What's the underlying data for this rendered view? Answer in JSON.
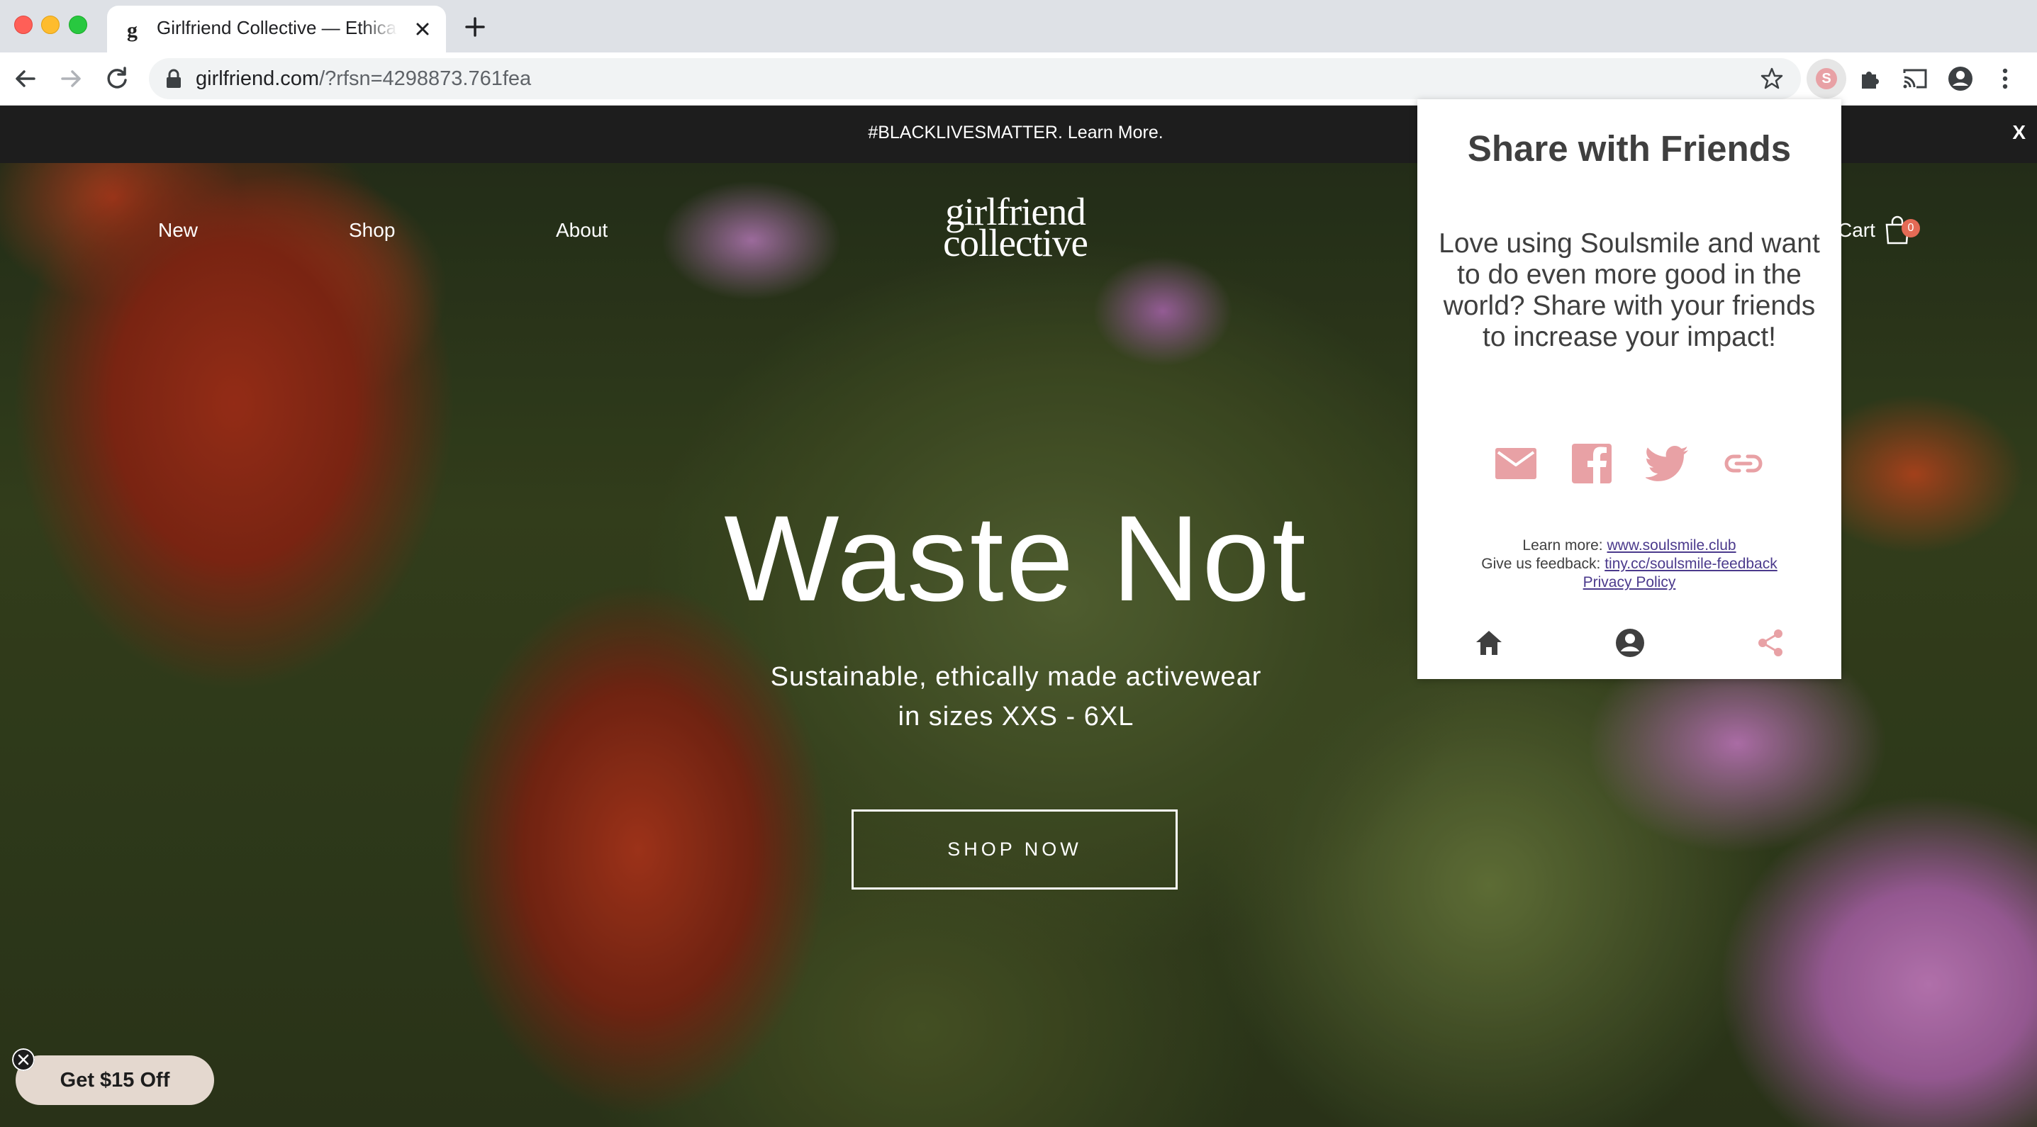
{
  "browser": {
    "tab_title": "Girlfriend Collective — Ethically Made Activewear",
    "tab_favicon": "g",
    "url_host": "girlfriend.com",
    "url_path": "/?rfsn=4298873.761fea",
    "extension_letter": "S"
  },
  "icons": {
    "back": "arrow-left-icon",
    "forward": "arrow-right-icon",
    "reload": "reload-icon",
    "lock": "lock-icon",
    "bookmark": "star-icon",
    "extensions": "puzzle-icon",
    "cast": "cast-icon",
    "profile": "account-circle-icon",
    "menu": "kebab-menu-icon"
  },
  "site": {
    "announcement": "#BLACKLIVESMATTER. Learn More.",
    "announcement_close": "X",
    "nav": {
      "new": "New",
      "shop": "Shop",
      "about": "About"
    },
    "logo_line1": "girlfriend",
    "logo_line2": "collective",
    "cart_label": "Cart",
    "cart_count": "0",
    "hero_title": "Waste Not",
    "hero_sub_line1": "Sustainable, ethically made activewear",
    "hero_sub_line2": "in sizes XXS - 6XL",
    "cta": "SHOP NOW",
    "promo": "Get $15 Off"
  },
  "popup": {
    "title": "Share with Friends",
    "body": "Love using Soulsmile and want to do even more good in the world? Share with your friends to increase your impact!",
    "learn_more_label": "Learn more:",
    "learn_more_link": "www.soulsmile.club",
    "feedback_label": "Give us feedback:",
    "feedback_link": "tiny.cc/soulsmile-feedback",
    "privacy_link": "Privacy Policy",
    "share_icons": [
      "email-icon",
      "facebook-icon",
      "twitter-icon",
      "link-icon"
    ],
    "nav_icons": [
      "home-icon",
      "account-icon",
      "share-icon"
    ]
  },
  "colors": {
    "accent_pink": "#e8a1a5",
    "announcement_bg": "#1d1d1d",
    "promo_bg": "#e4d8cf",
    "link_purple": "#4b3a8c"
  }
}
